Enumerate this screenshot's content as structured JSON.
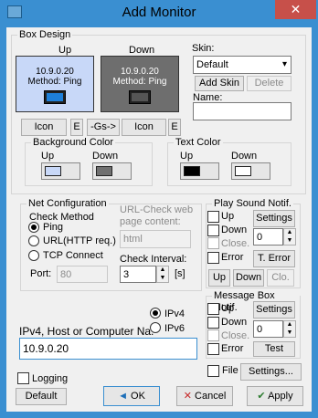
{
  "window": {
    "title": "Add Monitor",
    "close": "✕"
  },
  "box_design": {
    "label": "Box Design",
    "up_label": "Up",
    "down_label": "Down",
    "preview_up": {
      "line1": "10.9.0.20",
      "line2": "Method: Ping"
    },
    "preview_down": {
      "line1": "10.9.0.20",
      "line2": "Method: Ping"
    },
    "icon_button": "Icon",
    "e_button": "E",
    "gs_button": "-Gs->",
    "icon_button_2": "Icon",
    "e_button_2": "E",
    "skin_label": "Skin:",
    "skin_value": "Default",
    "add_skin": "Add Skin",
    "delete": "Delete",
    "name_label": "Name:",
    "name_value": "",
    "bg_color": {
      "label": "Background Color",
      "up": "Up",
      "down": "Down",
      "up_color": "#c8d8f8",
      "down_color": "#707070"
    },
    "text_color": {
      "label": "Text Color",
      "up": "Up",
      "down": "Down",
      "up_color": "#000000",
      "down_color": "#ffffff"
    }
  },
  "net": {
    "label": "Net Configuration",
    "check_method": "Check Method",
    "options": [
      "Ping",
      "URL(HTTP req.)",
      "TCP Connect"
    ],
    "selected": "Ping",
    "port_label": "Port:",
    "port_value": "80",
    "url_label_1": "URL-Check web",
    "url_label_2": "page content:",
    "url_value": "html",
    "interval_label": "Check Interval:",
    "interval_value": "3",
    "interval_unit": "[s]"
  },
  "sound": {
    "label": "Play Sound Notif.",
    "up": "Up",
    "down": "Down",
    "close": "Close.",
    "error": "Error",
    "settings": "Settings",
    "spin_value": "0",
    "t_error": "T. Error",
    "btn_up": "Up",
    "btn_down": "Down",
    "btn_clo": "Clo."
  },
  "message": {
    "label": "Message Box Notif.",
    "up": "Up",
    "down": "Down",
    "close": "Close.",
    "error": "Error",
    "settings": "Settings",
    "spin_value": "0",
    "test": "Test"
  },
  "host": {
    "label": "IPv4, Host or Computer Na.",
    "value": "10.9.0.20",
    "ipv4": "IPv4",
    "ipv6": "IPv6",
    "selected": "IPv4"
  },
  "file": {
    "label": "File",
    "settings": "Settings..."
  },
  "logging": "Logging",
  "footer": {
    "default": "Default",
    "ok": "OK",
    "cancel": "Cancel",
    "apply": "Apply"
  }
}
